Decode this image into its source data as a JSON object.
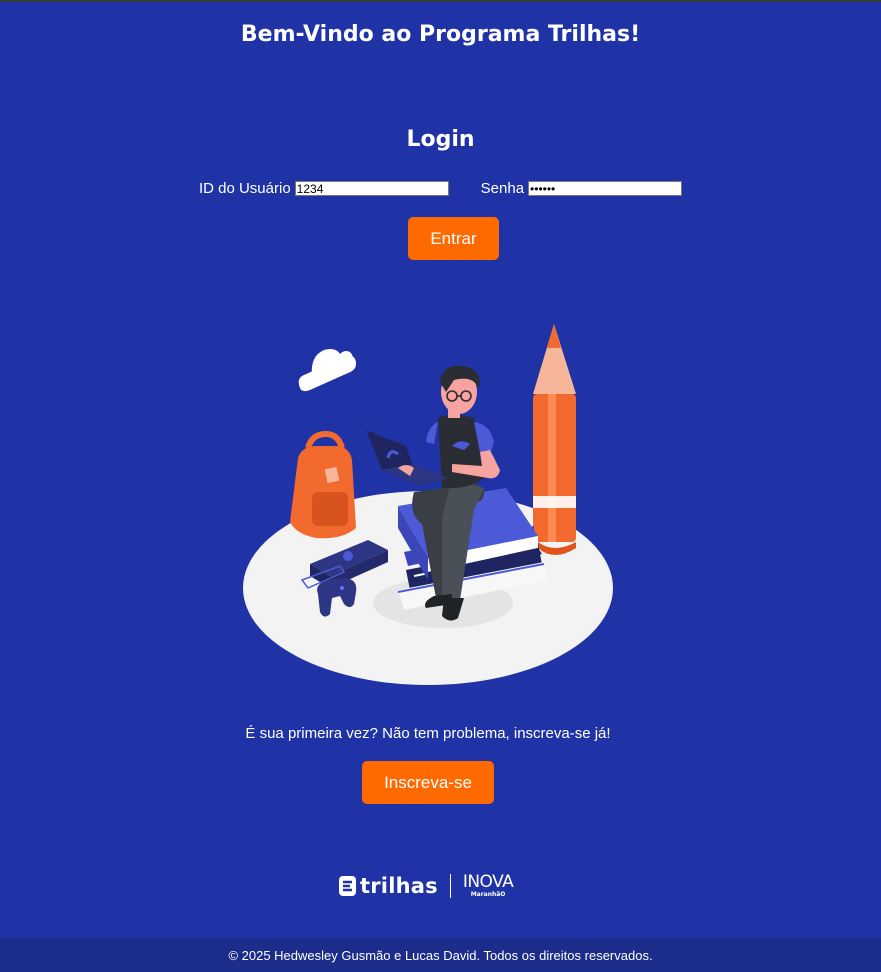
{
  "header": {
    "title": "Bem-Vindo ao Programa Trilhas!"
  },
  "login": {
    "title": "Login",
    "user_id_label": "ID do Usuário",
    "user_id_value": "1234",
    "password_label": "Senha",
    "password_value": "••••••",
    "submit_label": "Entrar"
  },
  "illustration": {
    "icon": "student-with-laptop-illustration"
  },
  "signup": {
    "prompt": "É sua primeira vez? Não tem problema, inscreva-se já!",
    "button_label": "Inscreva-se"
  },
  "logos": {
    "trilhas": "trilhas",
    "inova": "INOVA",
    "inova_sub": "MaranhãO"
  },
  "footer": {
    "copyright": "© 2025 Hedwesley Gusmão e Lucas David. Todos os direitos reservados."
  },
  "colors": {
    "background": "#2033a6",
    "accent": "#ff6a00",
    "footer": "#1c2c8a"
  }
}
